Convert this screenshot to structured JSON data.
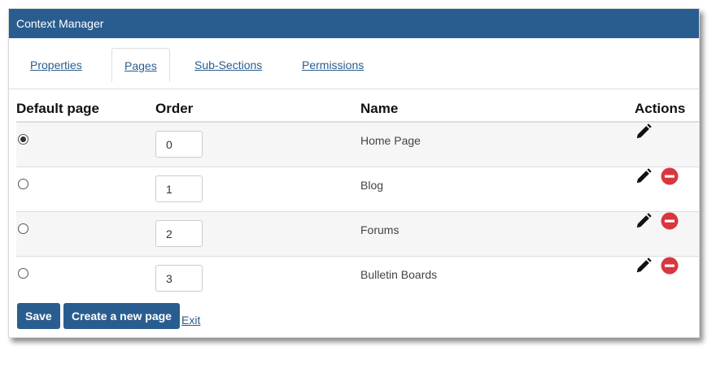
{
  "window": {
    "title": "Context Manager"
  },
  "tabs": [
    {
      "label": "Properties",
      "active": false
    },
    {
      "label": "Pages",
      "active": true
    },
    {
      "label": "Sub-Sections",
      "active": false
    },
    {
      "label": "Permissions",
      "active": false
    }
  ],
  "table": {
    "headers": {
      "default_page": "Default page",
      "order": "Order",
      "name": "Name",
      "actions": "Actions"
    },
    "rows": [
      {
        "default": true,
        "order": "0",
        "name": "Home Page",
        "editable": true,
        "removable": false
      },
      {
        "default": false,
        "order": "1",
        "name": "Blog",
        "editable": true,
        "removable": true
      },
      {
        "default": false,
        "order": "2",
        "name": "Forums",
        "editable": true,
        "removable": true
      },
      {
        "default": false,
        "order": "3",
        "name": "Bulletin Boards",
        "editable": true,
        "removable": true
      }
    ]
  },
  "buttons": {
    "save": "Save",
    "create": "Create a new page",
    "exit": "Exit"
  },
  "icons": {
    "edit": "pencil-icon",
    "remove": "remove-circle-icon"
  },
  "colors": {
    "accent": "#2a5d8f",
    "remove": "#d9363e"
  }
}
